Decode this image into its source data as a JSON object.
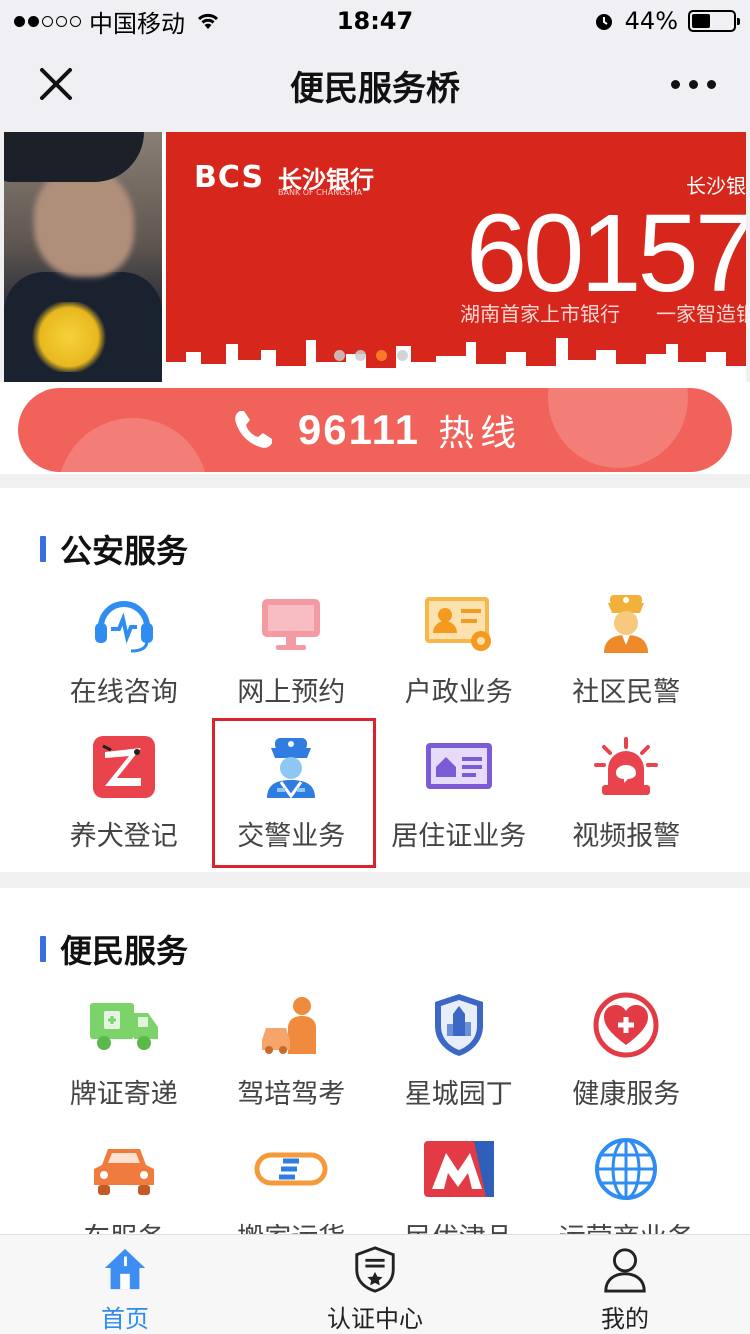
{
  "status_bar": {
    "carrier": "中国移动",
    "time": "18:47",
    "battery": "44%",
    "battery_fraction": 0.44
  },
  "nav": {
    "title": "便民服务桥"
  },
  "banner": {
    "brand": "BCS",
    "brand_cn": "长沙银行",
    "brand_en": "BANK OF CHANGSHA",
    "brand_right": "长沙银",
    "code": "60157",
    "slogan1": "湖南首家上市银行",
    "slogan2": "一家智造银",
    "active_slide": 3,
    "slide_count": 4
  },
  "hotline": {
    "number": "96111",
    "label": "热线"
  },
  "sections": [
    {
      "title": "公安服务",
      "items": [
        {
          "label": "在线咨询",
          "icon": "headset-icon"
        },
        {
          "label": "网上预约",
          "icon": "monitor-icon"
        },
        {
          "label": "户政业务",
          "icon": "id-card-icon"
        },
        {
          "label": "社区民警",
          "icon": "police-officer-icon"
        },
        {
          "label": "养犬登记",
          "icon": "dog-icon"
        },
        {
          "label": "交警业务",
          "icon": "traffic-police-icon",
          "highlight": true
        },
        {
          "label": "居住证业务",
          "icon": "residence-card-icon"
        },
        {
          "label": "视频报警",
          "icon": "alarm-siren-icon"
        }
      ]
    },
    {
      "title": "便民服务",
      "items": [
        {
          "label": "牌证寄递",
          "icon": "delivery-truck-icon"
        },
        {
          "label": "驾培驾考",
          "icon": "driving-school-icon"
        },
        {
          "label": "星城园丁",
          "icon": "shield-badge-icon"
        },
        {
          "label": "健康服务",
          "icon": "heart-health-icon"
        },
        {
          "label": "车服务",
          "icon": "car-icon"
        },
        {
          "label": "搬家运货",
          "icon": "moving-icon"
        },
        {
          "label": "民优津品",
          "icon": "mall-icon"
        },
        {
          "label": "运营商业务",
          "icon": "globe-icon"
        }
      ]
    }
  ],
  "tabs": [
    {
      "label": "首页",
      "icon": "home-icon",
      "active": true
    },
    {
      "label": "认证中心",
      "icon": "shield-star-icon",
      "active": false
    },
    {
      "label": "我的",
      "icon": "user-icon",
      "active": false
    }
  ],
  "colors": {
    "accent": "#3b6fe0",
    "hotline": "#f0625a",
    "banner_red": "#d7271c",
    "tab_active": "#2d8cf0",
    "highlight_border": "#d9232d"
  }
}
